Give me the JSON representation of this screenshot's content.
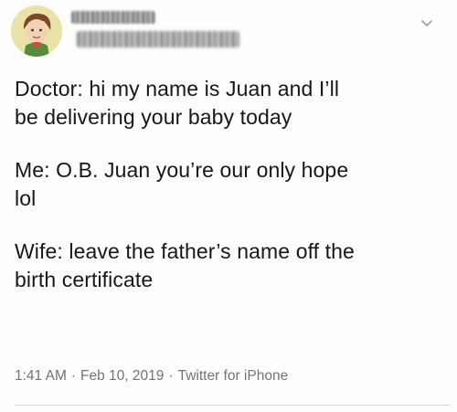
{
  "tweet": {
    "author": {
      "display_name": "",
      "handle": ""
    },
    "menu_icon": "chevron-down-icon",
    "paragraphs": [
      "Doctor: hi my name is Juan and I’ll\nbe delivering your baby today",
      "Me: O.B. Juan you’re our only hope\nlol",
      "Wife: leave the father’s name off the\nbirth certificate"
    ],
    "meta": {
      "time": "1:41 AM",
      "date": "Feb 10, 2019",
      "source": "Twitter for iPhone",
      "separator": "·"
    }
  },
  "colors": {
    "text": "#171717",
    "meta": "#6f7479",
    "divider": "#d9d9d9"
  }
}
